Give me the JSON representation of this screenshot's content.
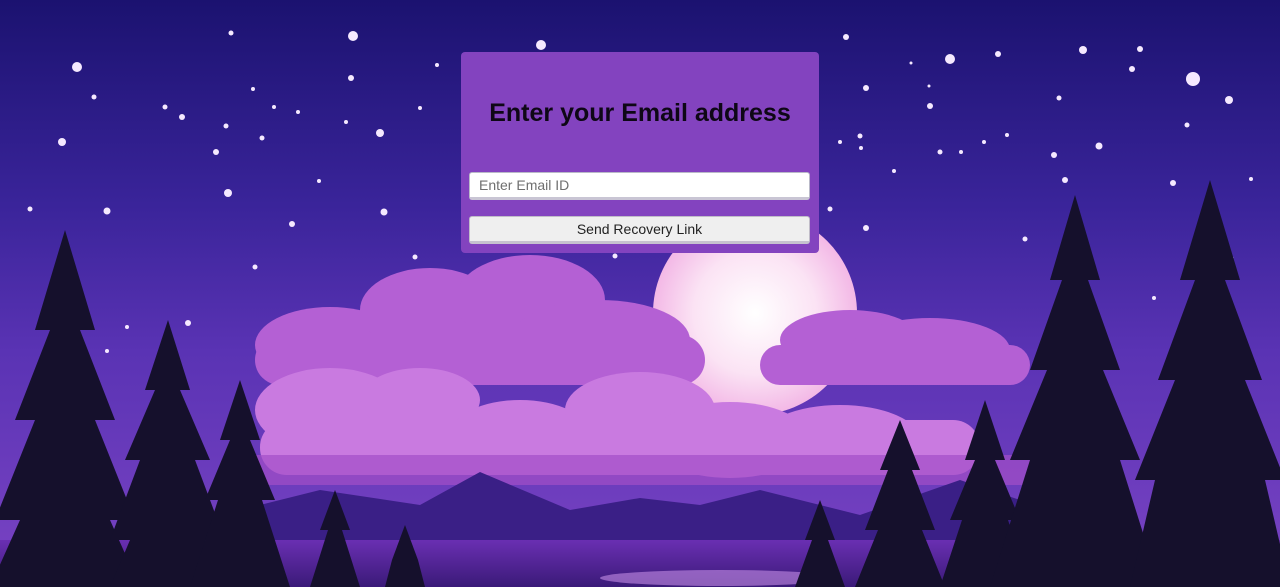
{
  "recovery_form": {
    "title": "Enter your Email address",
    "email_placeholder": "Enter Email ID",
    "email_value": "",
    "submit_label": "Send Recovery Link"
  },
  "background": {
    "scene": "night-sky-moon-clouds-pine-forest",
    "colors": {
      "sky_top": "#1d1270",
      "sky_mid": "#4a2aa8",
      "horizon": "#7a3fc0",
      "cloud": "#c576dc",
      "moon": "#fbe6f6",
      "trees": "#14102a",
      "card": "#8343bf"
    }
  }
}
